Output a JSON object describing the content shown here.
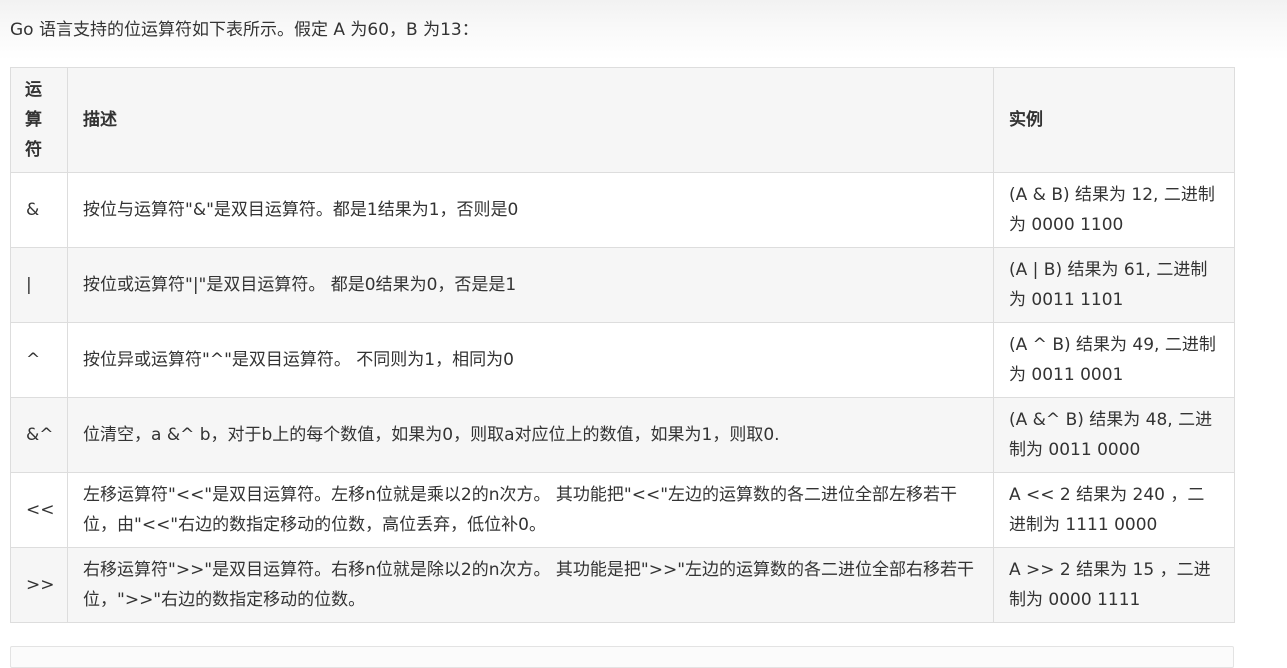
{
  "intro": "Go 语言支持的位运算符如下表所示。假定 A 为60，B 为13：",
  "table": {
    "headers": {
      "operator": "运算符",
      "description": "描述",
      "example": "实例"
    },
    "rows": [
      {
        "operator": "&",
        "description": "按位与运算符\"&\"是双目运算符。都是1结果为1，否则是0",
        "example": "(A & B) 结果为 12, 二进制为 0000 1100"
      },
      {
        "operator": "|",
        "description": "按位或运算符\"|\"是双目运算符。 都是0结果为0，否是是1",
        "example": "(A | B) 结果为 61, 二进制为 0011 1101"
      },
      {
        "operator": "^",
        "description": "按位异或运算符\"^\"是双目运算符。 不同则为1，相同为0",
        "example": "(A ^ B) 结果为 49, 二进制为 0011 0001"
      },
      {
        "operator": "&^",
        "description": "位清空，a &^ b，对于b上的每个数值，如果为0，则取a对应位上的数值，如果为1，则取0.",
        "example": "(A &^ B) 结果为 48, 二进制为 0011 0000"
      },
      {
        "operator": "<<",
        "description": "左移运算符\"<<\"是双目运算符。左移n位就是乘以2的n次方。 其功能把\"<<\"左边的运算数的各二进位全部左移若干位，由\"<<\"右边的数指定移动的位数，高位丢弃，低位补0。",
        "example": "A << 2 结果为 240 ，二进制为 1111 0000"
      },
      {
        "operator": ">>",
        "description": "右移运算符\">>\"是双目运算符。右移n位就是除以2的n次方。 其功能是把\">>\"左边的运算数的各二进位全部右移若干位，\">>\"右边的数指定移动的位数。",
        "example": "A >> 2 结果为 15 ，二进制为 0000 1111"
      }
    ]
  }
}
